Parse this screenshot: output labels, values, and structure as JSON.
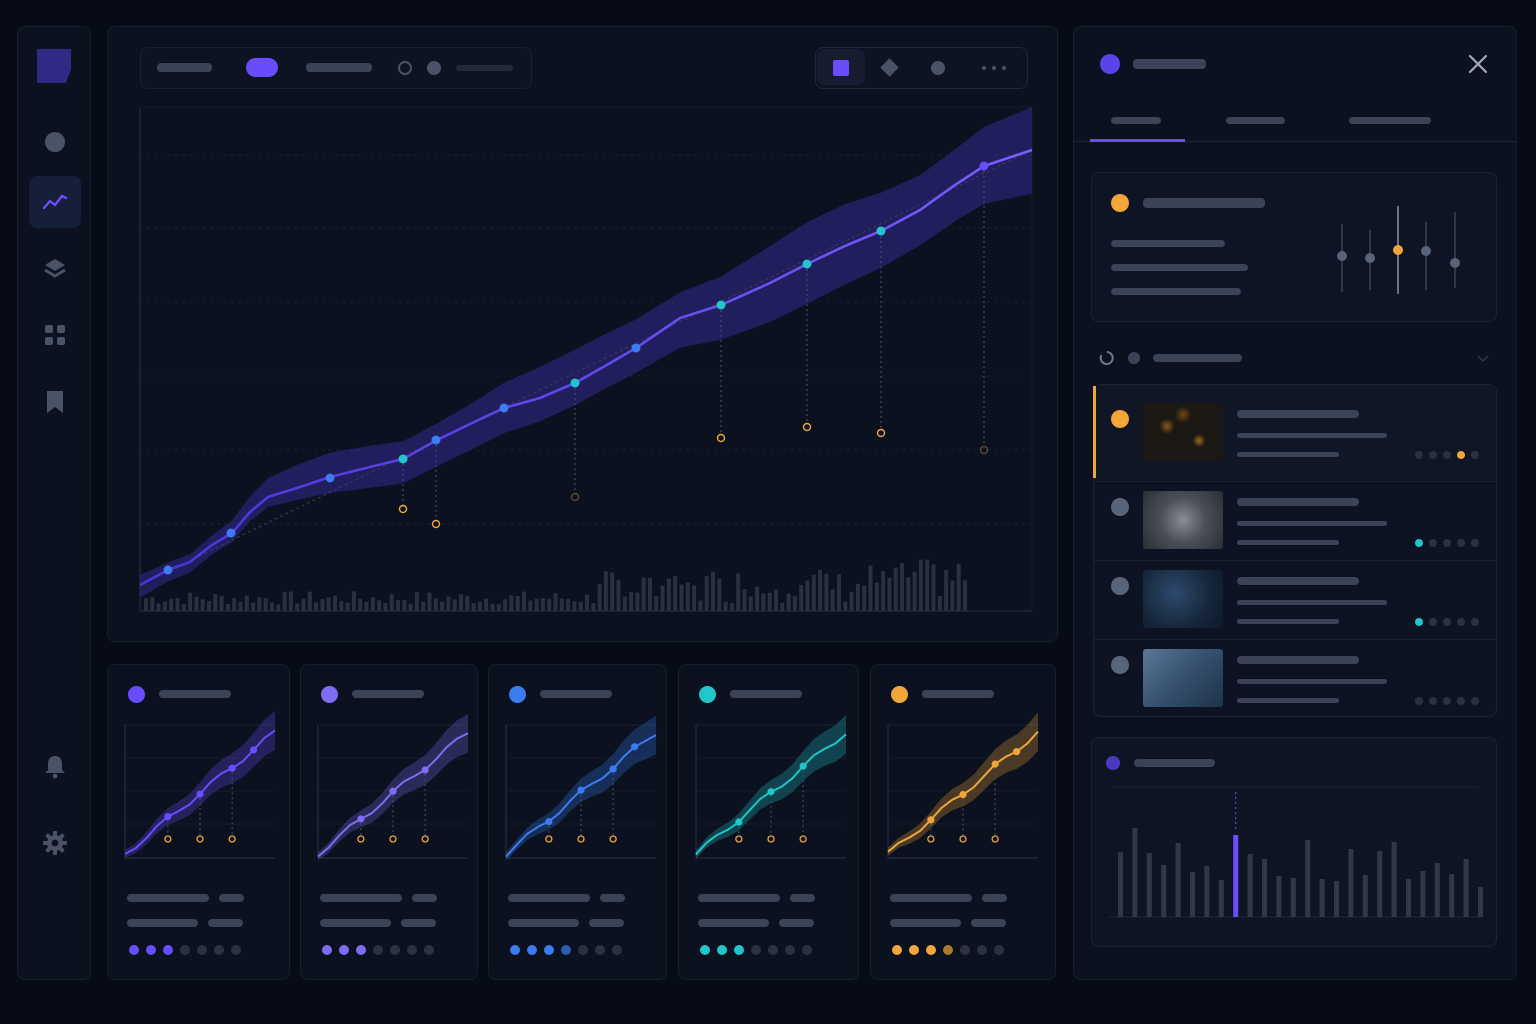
{
  "theme": {
    "background": "#070b15",
    "panel": "#0b111e",
    "accent_purple": "#6a4cff",
    "accent_lavender": "#7f6cf2",
    "accent_blue": "#3b7cf0",
    "accent_teal": "#20c6c9",
    "accent_orange": "#f0a63a"
  },
  "sidebar": {
    "logo": "app-logo",
    "items": [
      {
        "icon": "circle-icon",
        "active": false
      },
      {
        "icon": "trend-line-icon",
        "active": true
      },
      {
        "icon": "layers-icon",
        "active": false
      },
      {
        "icon": "grid-icon",
        "active": false
      },
      {
        "icon": "bookmark-icon",
        "active": false
      }
    ],
    "bottom_items": [
      {
        "icon": "bell-icon"
      },
      {
        "icon": "gear-icon"
      }
    ]
  },
  "main_chart": {
    "toolbar_left": {
      "active_chip_color": "#6a4cff",
      "items": [
        "filter-chip",
        "toggle-chip",
        "filter-chip",
        "radio-empty",
        "radio-filled",
        "slider-track"
      ]
    },
    "toolbar_right": {
      "view_modes": [
        "square-icon",
        "diamond-icon",
        "circle-icon",
        "more-icon"
      ],
      "active": "square-icon"
    }
  },
  "mini_cards": [
    {
      "color": "#6a4cff",
      "footer_dots": 7,
      "active_dots": 3
    },
    {
      "color": "#7f6cf2",
      "footer_dots": 7,
      "active_dots": 3
    },
    {
      "color": "#3b7cf0",
      "footer_dots": 7,
      "active_dots": 4
    },
    {
      "color": "#20c6c9",
      "footer_dots": 7,
      "active_dots": 3
    },
    {
      "color": "#f0a63a",
      "footer_dots": 7,
      "active_dots": 4
    }
  ],
  "right_panel": {
    "header_dot": "#6a4cff",
    "close": "close-icon",
    "tabs": [
      {
        "active": true
      },
      {
        "active": false
      },
      {
        "active": false
      }
    ],
    "controls_card": {
      "dot": "#f0a63a",
      "sliders": 5,
      "active_slider": 3
    },
    "list_header": {
      "icons": [
        "loading-icon",
        "status-dot",
        "chevron-down-icon"
      ]
    },
    "list": [
      {
        "active": true,
        "dot": "#f0a63a",
        "thumb": "orange-particles",
        "dots_color": "#f0a63a",
        "active_dot": 3
      },
      {
        "active": false,
        "dot": "#5a6478",
        "thumb": "gray-particles",
        "dots_color": "#20c6c9",
        "active_dot": 0
      },
      {
        "active": false,
        "dot": "#5a6478",
        "thumb": "blue-particles",
        "dots_color": "#20c6c9",
        "active_dot": 0
      },
      {
        "active": false,
        "dot": "#5a6478",
        "thumb": "steel-particles",
        "dots_color": "",
        "active_dot": -1
      }
    ],
    "histogram_card": {
      "dot": "#6a4cff",
      "highlight_index": 8
    }
  }
}
